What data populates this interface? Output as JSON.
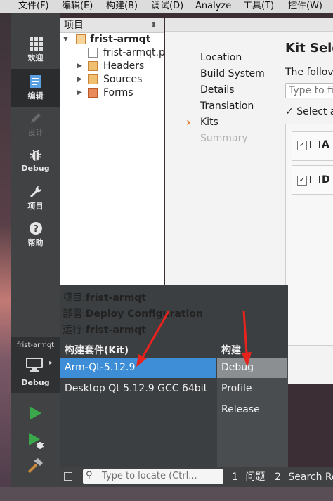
{
  "menubar": {
    "items": [
      "文件(F)",
      "编辑(E)",
      "构建(B)",
      "调试(D)",
      "Analyze",
      "工具(T)",
      "控件(W)"
    ]
  },
  "modes": [
    {
      "label": "欢迎",
      "icon": "grid-icon"
    },
    {
      "label": "编辑",
      "icon": "edit-document-icon",
      "active": true
    },
    {
      "label": "设计",
      "icon": "pencil-icon",
      "disabled": true
    },
    {
      "label": "Debug",
      "icon": "bug-icon"
    },
    {
      "label": "项目",
      "icon": "wrench-icon"
    },
    {
      "label": "帮助",
      "icon": "help-icon"
    }
  ],
  "target": {
    "project_name": "frist-armqt",
    "config": "Debug"
  },
  "tree": {
    "header": "项目",
    "items": [
      {
        "label": "frist-armqt",
        "bold": true
      },
      {
        "label": "frist-armqt.p"
      },
      {
        "label": "Headers"
      },
      {
        "label": "Sources"
      },
      {
        "label": "Forms"
      }
    ]
  },
  "wizard": {
    "steps": [
      "Location",
      "Build System",
      "Details",
      "Translation",
      "Kits",
      "Summary"
    ],
    "current_step": "Kits",
    "title": "Kit Sele",
    "text": "The follov",
    "filter_placeholder": "Type to fi",
    "select_all": "Select a",
    "kit_rows": [
      "A",
      "D"
    ]
  },
  "popup": {
    "project_label": "项目:",
    "project_value": "frist-armqt",
    "deploy_label": "部署:",
    "deploy_value": "Deploy Configuration",
    "run_label": "运行:",
    "run_value": "frist-armqt",
    "kits_header": "构建套件(Kit)",
    "build_header": "构建",
    "kits": [
      "Arm-Qt-5.12.9",
      "Desktop Qt 5.12.9 GCC 64bit"
    ],
    "selected_kit": "Arm-Qt-5.12.9",
    "builds": [
      "Debug",
      "Profile",
      "Release"
    ],
    "selected_build": "Debug"
  },
  "bottombar": {
    "locator_placeholder": "Type to locate (Ctrl...",
    "tab1_num": "1",
    "tab1_label": "问题",
    "tab2_num": "2",
    "tab2_label": "Search Res"
  },
  "colors": {
    "selection": "#3d8ed6",
    "annotation_arrow": "#e8231d",
    "modebar": "#404244",
    "run_green": "#3aa84a"
  }
}
